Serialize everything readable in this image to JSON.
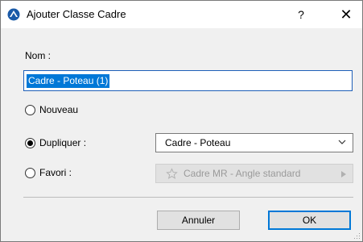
{
  "window": {
    "title": "Ajouter Classe Cadre",
    "help_label": "?",
    "close_label": "✕"
  },
  "form": {
    "name_label": "Nom :",
    "name_value": "Cadre - Poteau (1)",
    "options": [
      {
        "label": "Nouveau",
        "selected": false
      },
      {
        "label": "Dupliquer :",
        "selected": true
      },
      {
        "label": "Favori :",
        "selected": false
      }
    ],
    "duplicate_select_value": "Cadre - Poteau",
    "favorite_select_value": "Cadre MR - Angle standard"
  },
  "buttons": {
    "cancel": "Annuler",
    "ok": "OK"
  },
  "icons": {
    "app": "app-logo-icon",
    "star": "star-icon",
    "chevron": "chevron-down-icon",
    "arrow": "triangle-right-icon"
  },
  "colors": {
    "accent": "#0078d7",
    "selection_bg": "#0078d7",
    "dialog_bg": "#f0f0f0"
  }
}
